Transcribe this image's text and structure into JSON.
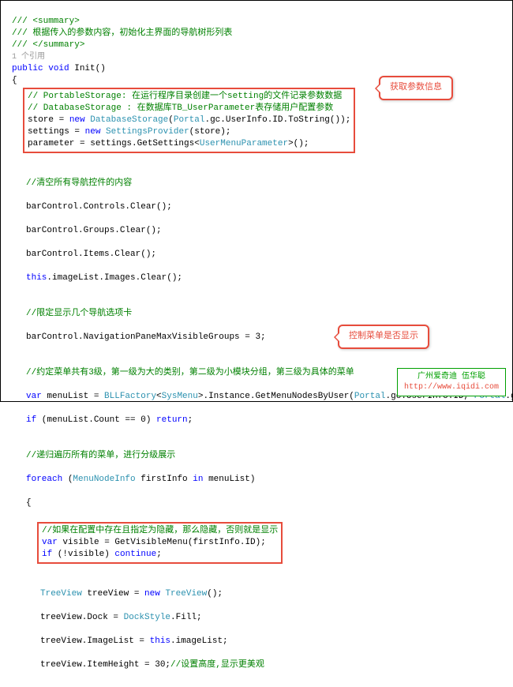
{
  "c0": "/// <summary>",
  "c1": "/// 根据传入的参数内容，初始化主界面的导航树形列表",
  "c2": "/// </summary>",
  "ref": "1 个引用",
  "kw_public": "public",
  "kw_void": "void",
  "fn": "Init",
  "paren": "()",
  "pc1": "// PortableStorage: 在运行程序目录创建一个setting的文件记录参数数据",
  "pc2": "// DatabaseStorage : 在数据库TB_UserParameter表存储用户配置参数",
  "l3a": "store = ",
  "kw_new": "new",
  "sp": " ",
  "t_ds": "DatabaseStorage",
  "l3b": "(",
  "t_portal": "Portal",
  "l3c": ".gc.UserInfo.ID.ToString());",
  "l4a": "settings = ",
  "t_sp": "SettingsProvider",
  "l4b": "(store);",
  "l5a": "parameter = settings.GetSettings<",
  "t_ump": "UserMenuParameter",
  "l5b": ">();",
  "cc1": "//清空所有导航控件的内容",
  "l6": "barControl.Controls.Clear();",
  "l7": "barControl.Groups.Clear();",
  "l8": "barControl.Items.Clear();",
  "kw_this": "this",
  "l9": ".imageList.Images.Clear();",
  "cc2": "//限定显示几个导航选项卡",
  "l10": "barControl.NavigationPaneMaxVisibleGroups = 3;",
  "cc3": "//约定菜单共有3级，第一级为大的类别，第二级为小模块分组，第三级为具体的菜单",
  "kw_var": "var",
  "l11a": " menuList = ",
  "t_bf": "BLLFactory",
  "l11b": "<",
  "t_sm": "SysMenu",
  "l11c": ">.Instance.GetMenuNodesByUser(",
  "l11d": ".gc.UserInfo.ID, ",
  "l11e": ".gc.SystemType);",
  "kw_if": "if",
  "l12": " (menuList.Count == 0) ",
  "kw_return": "return",
  "semi": ";",
  "cc4": "//递归遍历所有的菜单，进行分级展示",
  "kw_foreach": "foreach",
  "l13a": " (",
  "t_mni": "MenuNodeInfo",
  "l13b": " firstInfo ",
  "kw_in": "in",
  "l13c": " menuList)",
  "cc5": "//如果在配置中存在且指定为隐藏，那么隐藏，否则就是显示",
  "l14": " visible = GetVisibleMenu(firstInfo.ID);",
  "l15a": " (!visible) ",
  "kw_continue": "continue",
  "t_tv": "TreeView",
  "l16": " treeView = ",
  "l16b": "();",
  "l17a": "treeView.Dock = ",
  "t_dock": "DockStyle",
  "l17b": ".Fill;",
  "l18": "treeView.ImageList = ",
  "l18b": ".imageList;",
  "l19a": "treeView.ItemHeight = 30;",
  "cc6": "//设置高度,显示更美观",
  "callout1": "获取参数信息",
  "callout2": "控制菜单是否显示",
  "logo1": "广州爱奇迪 伍华聪",
  "logo2": "http://www.iqidi.com"
}
